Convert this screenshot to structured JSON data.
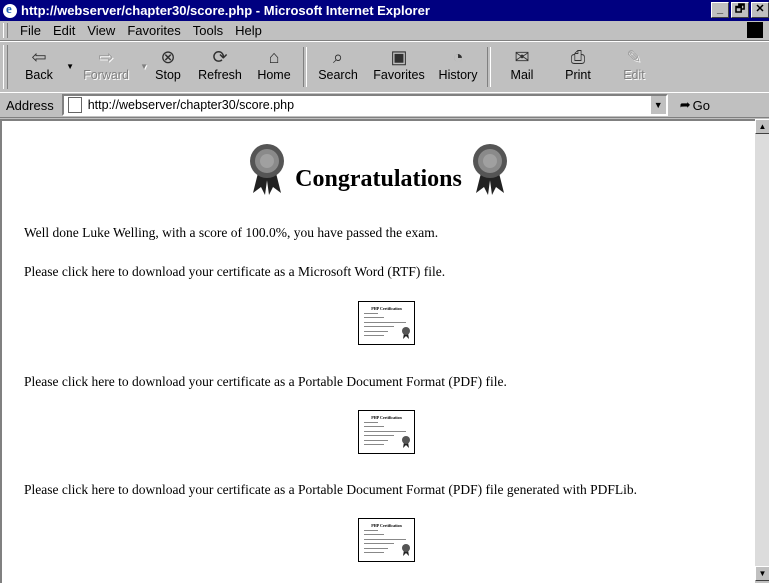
{
  "window": {
    "title": "http://webserver/chapter30/score.php - Microsoft Internet Explorer",
    "controls": [
      "_",
      "🗗",
      "✕"
    ]
  },
  "menu": [
    "File",
    "Edit",
    "View",
    "Favorites",
    "Tools",
    "Help"
  ],
  "toolbar": {
    "buttons": [
      {
        "label": "Back",
        "icon": "back-arrow-icon",
        "enabled": true
      },
      {
        "label": "Forward",
        "icon": "forward-arrow-icon",
        "enabled": false
      },
      {
        "label": "Stop",
        "icon": "stop-icon",
        "enabled": true
      },
      {
        "label": "Refresh",
        "icon": "refresh-icon",
        "enabled": true
      },
      {
        "label": "Home",
        "icon": "home-icon",
        "enabled": true
      },
      {
        "label": "Search",
        "icon": "search-icon",
        "enabled": true
      },
      {
        "label": "Favorites",
        "icon": "favorites-icon",
        "enabled": true
      },
      {
        "label": "History",
        "icon": "history-icon",
        "enabled": true
      },
      {
        "label": "Mail",
        "icon": "mail-icon",
        "enabled": true
      },
      {
        "label": "Print",
        "icon": "print-icon",
        "enabled": true
      },
      {
        "label": "Edit",
        "icon": "edit-icon",
        "enabled": false
      }
    ]
  },
  "address": {
    "label": "Address",
    "value": "http://webserver/chapter30/score.php",
    "go_label": "Go"
  },
  "page": {
    "heading": "Congratulations",
    "result_text": "Well done Luke Welling, with a score of 100.0%, you have passed the exam.",
    "downloads": [
      "Please click here to download your certificate as a Microsoft Word (RTF) file.",
      "Please click here to download your certificate as a Portable Document Format (PDF) file.",
      "Please click here to download your certificate as a Portable Document Format (PDF) file generated with PDFLib."
    ],
    "certificate_thumb_title": "PHP Certification"
  },
  "colors": {
    "titlebar": "#000080",
    "chrome": "#c0c0c0",
    "rosette": "#808080"
  }
}
